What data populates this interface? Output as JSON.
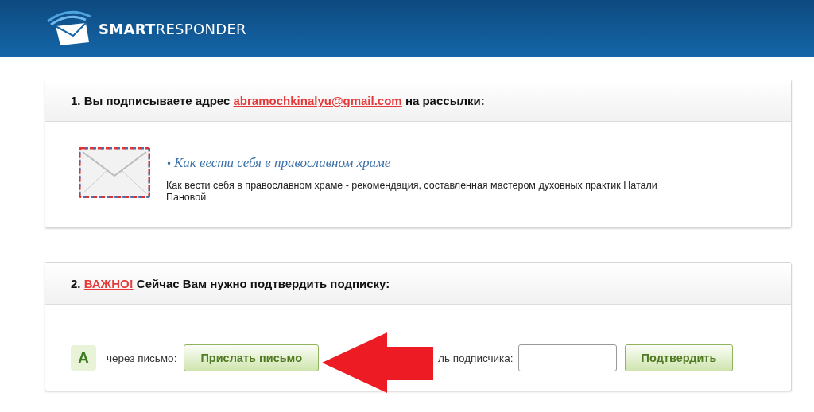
{
  "header": {
    "logo": "**SMART**RESPONDER"
  },
  "step1": {
    "title_before": "1. Вы подписываете адрес ",
    "email": "abramochkinalyu@gmail.com",
    "title_after": " на рассылки:",
    "list": {
      "bullet": "•",
      "name": "Как вести себя в православном храме",
      "description": "Как вести себя в православном храме - рекомендация, составленная мастером духовных практик Натали Пановой"
    }
  },
  "step2": {
    "title_before": "2. ",
    "important": "ВАЖНО!",
    "title_after": " Сейчас Вам нужно подтвердить подписку:",
    "option_badge": "А",
    "option_label": "через письмо:",
    "send_button": "Прислать письмо",
    "code_label": "ль подписчика:",
    "confirm_button": "Подтвердить"
  }
}
